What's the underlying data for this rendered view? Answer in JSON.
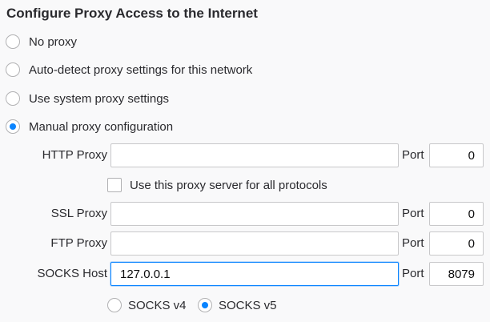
{
  "title": "Configure Proxy Access to the Internet",
  "options": {
    "no_proxy": "No proxy",
    "auto_detect": "Auto-detect proxy settings for this network",
    "system": "Use system proxy settings",
    "manual": "Manual proxy configuration",
    "selected": "manual"
  },
  "http": {
    "label": "HTTP Proxy",
    "value": "",
    "port_label": "Port",
    "port": "0"
  },
  "all_protocols": {
    "label": "Use this proxy server for all protocols",
    "checked": false
  },
  "ssl": {
    "label": "SSL Proxy",
    "value": "",
    "port_label": "Port",
    "port": "0"
  },
  "ftp": {
    "label": "FTP Proxy",
    "value": "",
    "port_label": "Port",
    "port": "0"
  },
  "socks": {
    "label": "SOCKS Host",
    "value": "127.0.0.1",
    "port_label": "Port",
    "port": "8079"
  },
  "socks_version": {
    "v4": "SOCKS v4",
    "v5": "SOCKS v5",
    "selected": "v5"
  },
  "colors": {
    "accent": "#0a84ff",
    "border": "#c8c8ca",
    "background": "#f9f9fa"
  }
}
